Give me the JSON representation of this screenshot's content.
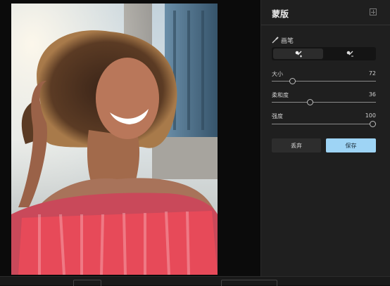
{
  "panel": {
    "title": "蒙版",
    "brush_section_label": "画笔",
    "brush_modes": [
      {
        "icon": "brush-add-icon",
        "active": true
      },
      {
        "icon": "brush-erase-icon",
        "active": false
      }
    ],
    "sliders": [
      {
        "label": "大小",
        "value": "72",
        "fraction": 0.18
      },
      {
        "label": "柔和度",
        "value": "36",
        "fraction": 0.36
      },
      {
        "label": "强度",
        "value": "100",
        "fraction": 1.0
      }
    ],
    "discard_label": "丢弃",
    "save_label": "保存"
  },
  "colors": {
    "accent": "#9ed4f5",
    "mask_overlay": "#ff4a5a"
  }
}
